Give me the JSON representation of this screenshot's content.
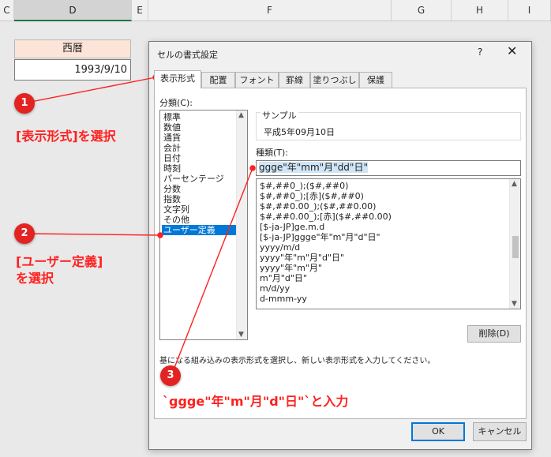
{
  "columns": [
    "C",
    "D",
    "E",
    "F",
    "G",
    "H",
    "I"
  ],
  "sheet": {
    "header_cell": "西暦",
    "value_cell": "1993/9/10"
  },
  "dialog": {
    "title": "セルの書式設定",
    "help": "?",
    "close": "✕",
    "tabs": [
      "表示形式",
      "配置",
      "フォント",
      "罫線",
      "塗りつぶし",
      "保護"
    ],
    "category_label": "分類(C):",
    "categories": [
      "標準",
      "数値",
      "通貨",
      "会計",
      "日付",
      "時刻",
      "パーセンテージ",
      "分数",
      "指数",
      "文字列",
      "その他",
      "ユーザー定義"
    ],
    "selected_category": "ユーザー定義",
    "sample_label": "サンプル",
    "sample_value": "平成5年09月10日",
    "type_label": "種類(T):",
    "type_value": "ggge\"年\"mm\"月\"dd\"日\"",
    "formats": [
      "$#,##0_);($#,##0)",
      "$#,##0_);[赤]($#,##0)",
      "$#,##0.00_);($#,##0.00)",
      "$#,##0.00_);[赤]($#,##0.00)",
      "[$-ja-JP]ge.m.d",
      "[$-ja-JP]ggge\"年\"m\"月\"d\"日\"",
      "yyyy/m/d",
      "yyyy\"年\"m\"月\"d\"日\"",
      "yyyy\"年\"m\"月\"",
      "m\"月\"d\"日\"",
      "m/d/yy",
      "d-mmm-yy"
    ],
    "delete_button": "削除(D)",
    "description": "基になる組み込みの表示形式を選択し、新しい表示形式を入力してください。",
    "ok_button": "OK",
    "cancel_button": "キャンセル"
  },
  "annotations": {
    "badge1": "1",
    "badge2": "2",
    "badge3": "3",
    "text1": "[表示形式]を選択",
    "text2a": "[ユーザー定義]",
    "text2b": "を選択",
    "text3": "`ggge\"年\"m\"月\"d\"日\"`と入力",
    "color": "#ff2020"
  }
}
